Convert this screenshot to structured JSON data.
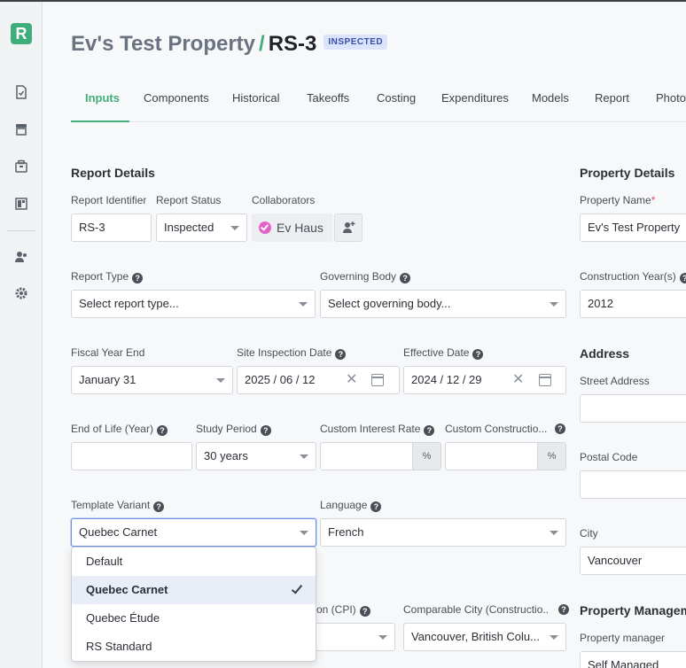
{
  "app": {
    "logo_letter": "R"
  },
  "sidebar": {
    "icons": [
      "document-check-icon",
      "storefront-icon",
      "briefcase-icon",
      "layout-icon",
      "users-icon",
      "gear-icon"
    ]
  },
  "header": {
    "property_name": "Ev's Test Property",
    "separator": "/",
    "report_code": "RS-3",
    "status_badge": "INSPECTED"
  },
  "tabs": [
    "Inputs",
    "Components",
    "Historical",
    "Takeoffs",
    "Costing",
    "Expenditures",
    "Models",
    "Report",
    "Photos"
  ],
  "report_details": {
    "title": "Report Details",
    "report_identifier": {
      "label": "Report Identifier",
      "value": "RS-3"
    },
    "report_status": {
      "label": "Report Status",
      "value": "Inspected"
    },
    "collaborators": {
      "label": "Collaborators",
      "chip": "Ev Haus"
    },
    "report_type": {
      "label": "Report Type",
      "value": "Select report type..."
    },
    "governing_body": {
      "label": "Governing Body",
      "value": "Select governing body..."
    },
    "fiscal_year_end": {
      "label": "Fiscal Year End",
      "value": "January 31"
    },
    "site_inspection_date": {
      "label": "Site Inspection Date",
      "value": "2025 / 06 / 12"
    },
    "effective_date": {
      "label": "Effective Date",
      "value": "2024 / 12 / 29"
    },
    "end_of_life": {
      "label": "End of Life (Year)",
      "value": ""
    },
    "study_period": {
      "label": "Study Period",
      "value": "30 years"
    },
    "custom_interest_rate": {
      "label": "Custom Interest Rate",
      "value": "",
      "suffix": "%"
    },
    "custom_construction": {
      "label": "Custom Constructio...",
      "value": "",
      "suffix": "%"
    },
    "template_variant": {
      "label": "Template Variant",
      "value": "Quebec Carnet",
      "options": [
        "Default",
        "Quebec Carnet",
        "Quebec Étude",
        "RS Standard"
      ],
      "selected_option": "Quebec Carnet"
    },
    "language": {
      "label": "Language",
      "value": "French"
    },
    "cpi_label": "on (CPI)",
    "comparable_city": {
      "label": "Comparable City (Constructio...",
      "value": "Vancouver, British Colu..."
    }
  },
  "property_details": {
    "title": "Property Details",
    "property_name": {
      "label": "Property Name",
      "required_mark": "*",
      "value": "Ev's Test Property"
    },
    "construction_years": {
      "label": "Construction Year(s)",
      "value": "2012"
    },
    "address_title": "Address",
    "street_address": {
      "label": "Street Address",
      "value": ""
    },
    "postal_code": {
      "label": "Postal Code",
      "value": ""
    },
    "city": {
      "label": "City",
      "value": "Vancouver"
    },
    "management_title": "Property Managem",
    "property_manager": {
      "label": "Property manager",
      "value": "Self Managed"
    }
  },
  "colors": {
    "accent": "#3fae7a",
    "badge_bg": "#dbe4fb",
    "badge_text": "#3a4ea8"
  }
}
